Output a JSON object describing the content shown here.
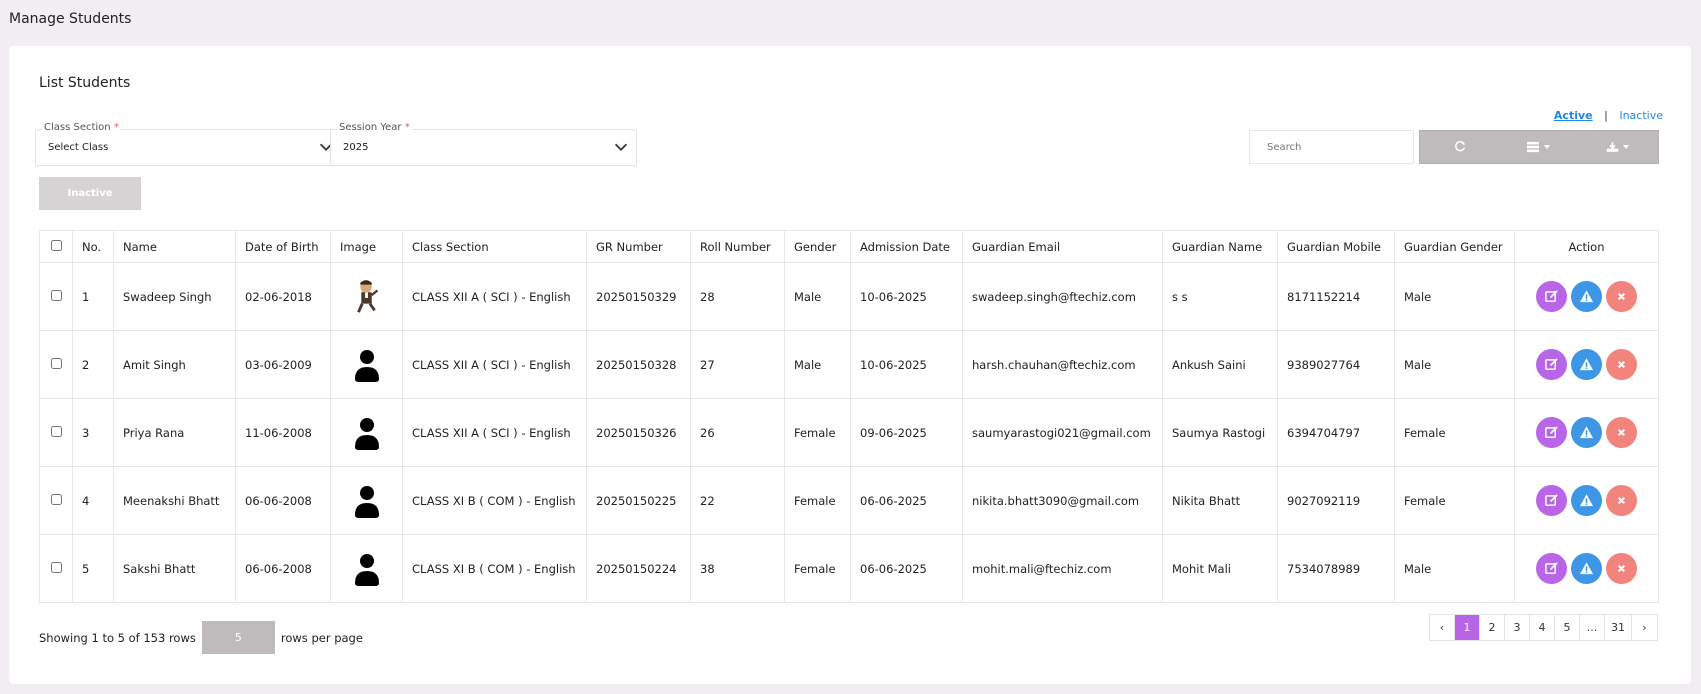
{
  "page": {
    "title": "Manage Students"
  },
  "card": {
    "title": "List Students"
  },
  "filters": {
    "class_section": {
      "label": "Class Section",
      "required_mark": "*",
      "value": "Select Class"
    },
    "session_year": {
      "label": "Session Year",
      "required_mark": "*",
      "value": "2025"
    }
  },
  "inactive_button": "Inactive",
  "status_links": {
    "active": "Active",
    "separator": "|",
    "inactive": "Inactive"
  },
  "search": {
    "placeholder": "Search"
  },
  "toolbar": {
    "icons": [
      "refresh-icon",
      "columns-icon",
      "export-icon"
    ]
  },
  "table": {
    "headers": [
      "No.",
      "Name",
      "Date of Birth",
      "Image",
      "Class Section",
      "GR Number",
      "Roll Number",
      "Gender",
      "Admission Date",
      "Guardian Email",
      "Guardian Name",
      "Guardian Mobile",
      "Guardian Gender",
      "Action"
    ],
    "rows": [
      {
        "no": "1",
        "name": "Swadeep Singh",
        "dob": "02-06-2018",
        "image": "cartoon-avatar",
        "class_section": "CLASS XII A ( SCI ) - English",
        "gr": "20250150329",
        "roll": "28",
        "gender": "Male",
        "admission": "10-06-2025",
        "g_email": "swadeep.singh@ftechiz.com",
        "g_name": "s s",
        "g_mobile": "8171152214",
        "g_gender": "Male"
      },
      {
        "no": "2",
        "name": "Amit Singh",
        "dob": "03-06-2009",
        "image": "person-icon",
        "class_section": "CLASS XII A ( SCI ) - English",
        "gr": "20250150328",
        "roll": "27",
        "gender": "Male",
        "admission": "10-06-2025",
        "g_email": "harsh.chauhan@ftechiz.com",
        "g_name": "Ankush Saini",
        "g_mobile": "9389027764",
        "g_gender": "Male"
      },
      {
        "no": "3",
        "name": "Priya Rana",
        "dob": "11-06-2008",
        "image": "person-icon",
        "class_section": "CLASS XII A ( SCI ) - English",
        "gr": "20250150326",
        "roll": "26",
        "gender": "Female",
        "admission": "09-06-2025",
        "g_email": "saumyarastogi021@gmail.com",
        "g_name": "Saumya Rastogi",
        "g_mobile": "6394704797",
        "g_gender": "Female"
      },
      {
        "no": "4",
        "name": "Meenakshi Bhatt",
        "dob": "06-06-2008",
        "image": "person-icon",
        "class_section": "CLASS XI B ( COM ) - English",
        "gr": "20250150225",
        "roll": "22",
        "gender": "Female",
        "admission": "06-06-2025",
        "g_email": "nikita.bhatt3090@gmail.com",
        "g_name": "Nikita Bhatt",
        "g_mobile": "9027092119",
        "g_gender": "Female"
      },
      {
        "no": "5",
        "name": "Sakshi Bhatt",
        "dob": "06-06-2008",
        "image": "person-icon",
        "class_section": "CLASS XI B ( COM ) - English",
        "gr": "20250150224",
        "roll": "38",
        "gender": "Female",
        "admission": "06-06-2025",
        "g_email": "mohit.mali@ftechiz.com",
        "g_name": "Mohit Mali",
        "g_mobile": "7534078989",
        "g_gender": "Male"
      }
    ]
  },
  "footer": {
    "showing": "Showing 1 to 5 of 153 rows",
    "rows_per_page_value": "5",
    "rows_per_page_label": "rows per page"
  },
  "pagination": {
    "prev": "‹",
    "pages": [
      "1",
      "2",
      "3",
      "4",
      "5",
      "...",
      "31"
    ],
    "current": "1",
    "next": "›"
  },
  "colors": {
    "accent": "#b865e8",
    "info": "#3e97e6",
    "danger": "#f3847d",
    "link": "#1e88e5"
  }
}
